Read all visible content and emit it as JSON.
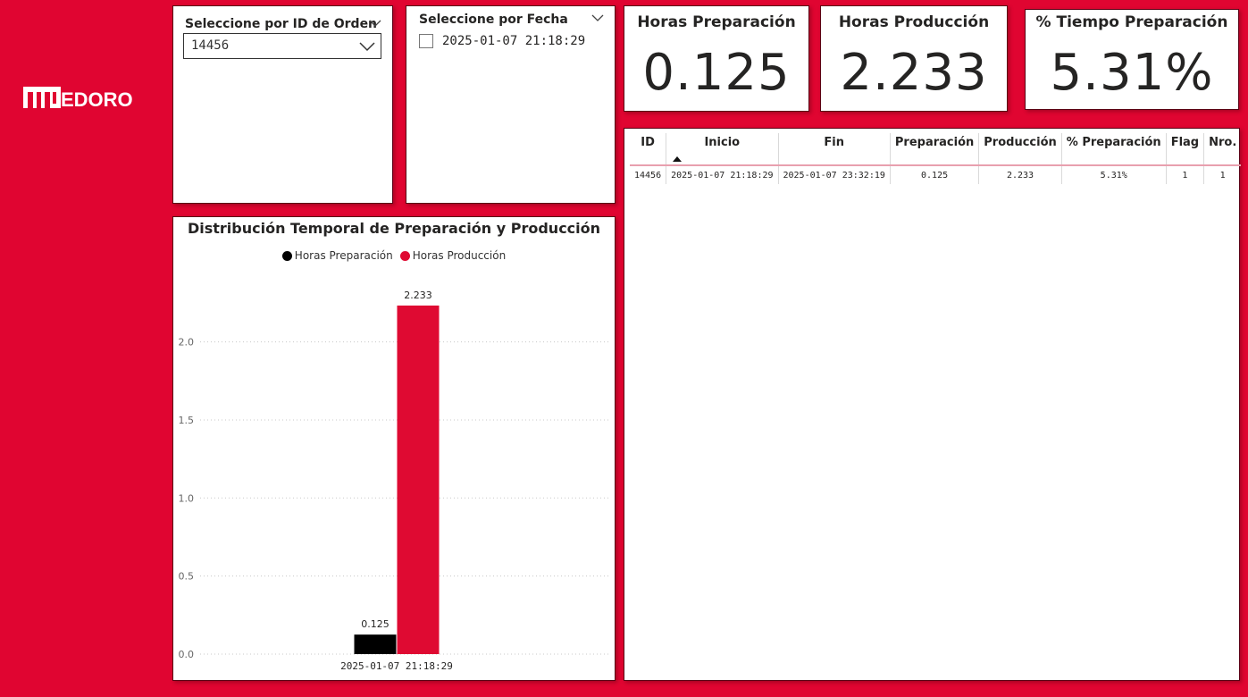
{
  "logo": {
    "text": "EDORO"
  },
  "slicers": {
    "order": {
      "title": "Seleccione por ID de Orden",
      "selected": "14456"
    },
    "date": {
      "title": "Seleccione por Fecha",
      "option": "2025-01-07 21:18:29",
      "checked": false
    }
  },
  "kpis": [
    {
      "title": "Horas Preparación",
      "value": "0.125"
    },
    {
      "title": "Horas Producción",
      "value": "2.233"
    },
    {
      "title": "% Tiempo Preparación",
      "value": "5.31%"
    }
  ],
  "table": {
    "columns": [
      "ID",
      "Inicio",
      "Fin",
      "Preparación",
      "Producción",
      "% Preparación",
      "Flag",
      "Nro."
    ],
    "sorted_column": "Inicio",
    "sort_direction": "ascending",
    "rows": [
      [
        "14456",
        "2025-01-07 21:18:29",
        "2025-01-07 23:32:19",
        "0.125",
        "2.233",
        "5.31%",
        "1",
        "1"
      ]
    ]
  },
  "colors": {
    "background": "#e00531",
    "series_preparacion": "#000000",
    "series_produccion": "#df0a32"
  },
  "chart_data": {
    "type": "bar",
    "title": "Distribución Temporal de Preparación y Producción",
    "categories": [
      "2025-01-07 21:18:29"
    ],
    "series": [
      {
        "name": "Horas Preparación",
        "values": [
          0.125
        ],
        "color": "#000000"
      },
      {
        "name": "Horas Producción",
        "values": [
          2.233
        ],
        "color": "#df0a32"
      }
    ],
    "yticks": [
      "0.0",
      "0.5",
      "1.0",
      "1.5",
      "2.0"
    ],
    "ylim": [
      0,
      2.45
    ],
    "grid": true,
    "legend_position": "top-center",
    "data_labels": [
      "0.125",
      "2.233"
    ]
  }
}
